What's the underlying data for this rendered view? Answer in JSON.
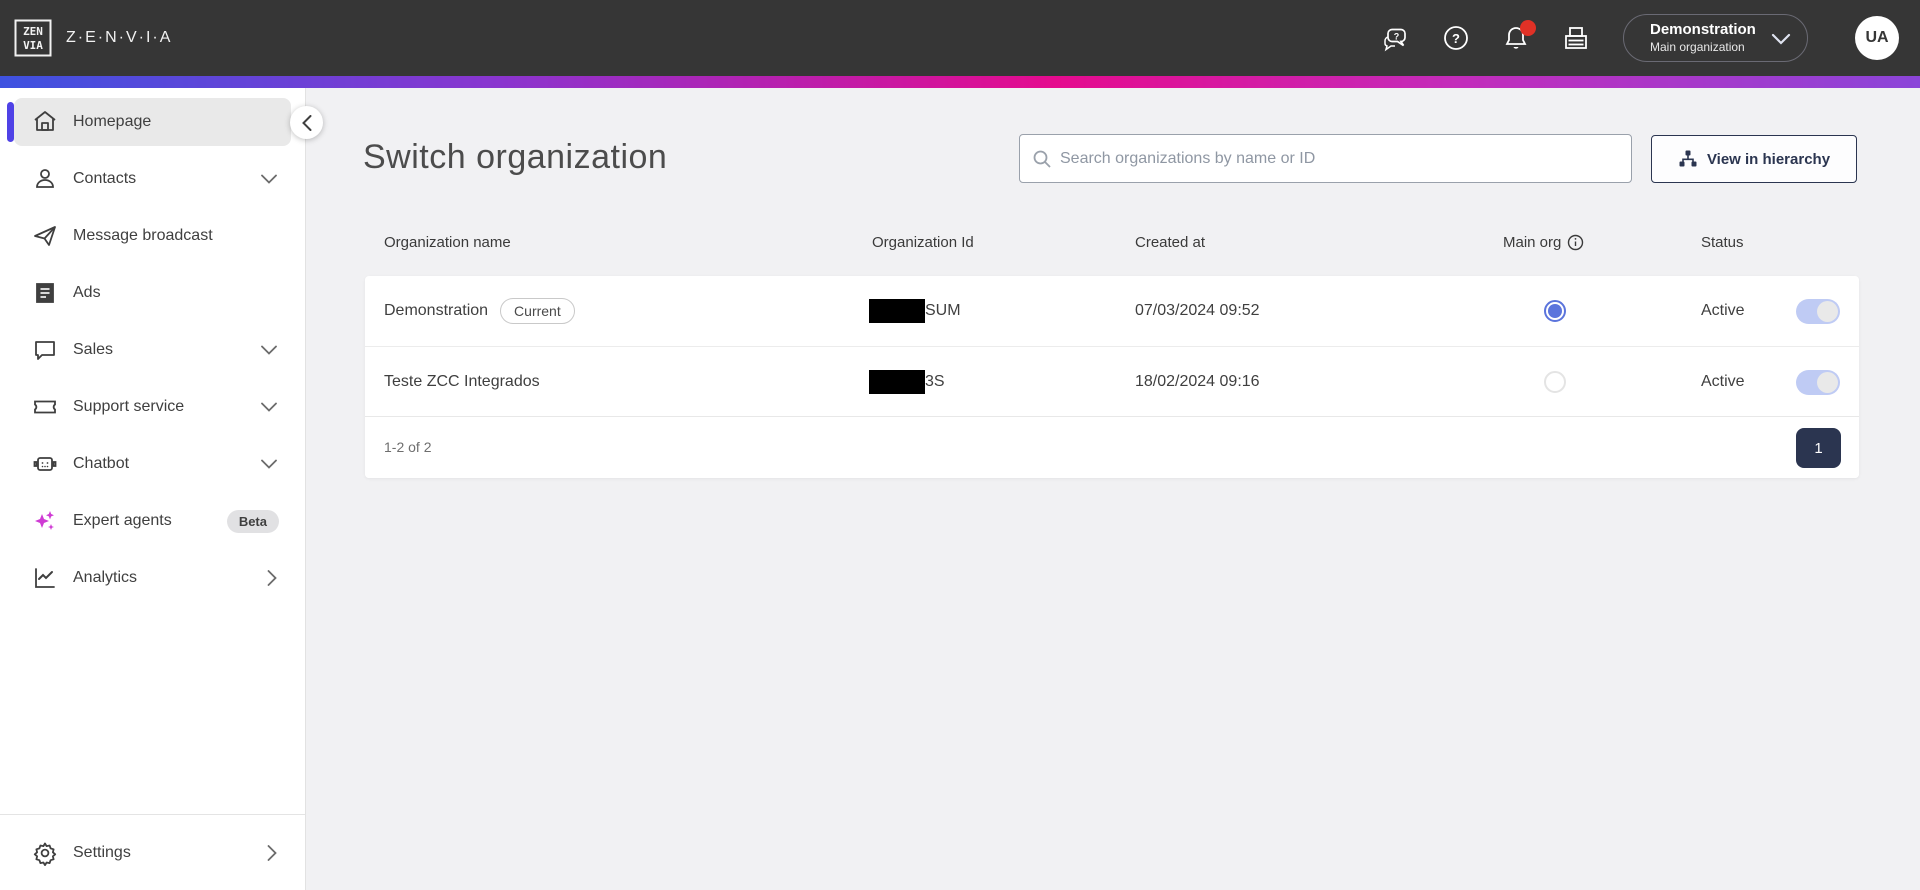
{
  "topbar": {
    "brand": "Z·E·N·V·I·A",
    "logo_top": "ZEN",
    "logo_bottom": "VIA",
    "icons": [
      "chat-support",
      "help",
      "notifications",
      "store"
    ],
    "org_switcher": {
      "name": "Demonstration",
      "subtitle": "Main organization"
    },
    "avatar_initials": "UA"
  },
  "sidebar": {
    "items": [
      {
        "label": "Homepage",
        "icon": "home",
        "active": true
      },
      {
        "label": "Contacts",
        "icon": "person",
        "chevron": "down"
      },
      {
        "label": "Message broadcast",
        "icon": "send"
      },
      {
        "label": "Ads",
        "icon": "news"
      },
      {
        "label": "Sales",
        "icon": "chat-bubble",
        "chevron": "down"
      },
      {
        "label": "Support service",
        "icon": "ticket",
        "chevron": "down"
      },
      {
        "label": "Chatbot",
        "icon": "robot",
        "chevron": "down"
      },
      {
        "label": "Expert agents",
        "icon": "sparkles",
        "badge": "Beta"
      },
      {
        "label": "Analytics",
        "icon": "line-chart",
        "chevron": "right"
      }
    ],
    "footer_item": {
      "label": "Settings",
      "icon": "gear",
      "chevron": "right"
    }
  },
  "main": {
    "title": "Switch organization",
    "search": {
      "placeholder": "Search organizations by name or ID"
    },
    "hierarchy_button": "View in hierarchy",
    "table": {
      "headers": [
        "Organization name",
        "Organization Id",
        "Created at",
        "Main org",
        "Status"
      ],
      "rows": [
        {
          "name": "Demonstration",
          "badge": "Current",
          "org_id_visible": "SUM",
          "org_id_redacted": true,
          "created_at": "07/03/2024 09:52",
          "main_org_selected": true,
          "status": "Active",
          "status_on": true
        },
        {
          "name": "Teste ZCC Integrados",
          "org_id_visible": "3S",
          "org_id_redacted": true,
          "created_at": "18/02/2024 09:16",
          "main_org_selected": false,
          "status": "Active",
          "status_on": true
        }
      ],
      "pagination": {
        "range_label": "1-2 of 2",
        "page": "1"
      }
    }
  },
  "colors": {
    "topbar_bg": "#363636",
    "gradient": [
      "#3e52e0",
      "#8a35cf",
      "#e50b8e",
      "#c32cbb",
      "#8b45d9"
    ],
    "active_indicator": "#4f42e6",
    "navy": "#2b3550",
    "radio_blue": "#5b74dc",
    "toggle_track": "#bfcbf4",
    "notification_red": "#e03126",
    "expert_sparkle": "#cf3bd4"
  }
}
